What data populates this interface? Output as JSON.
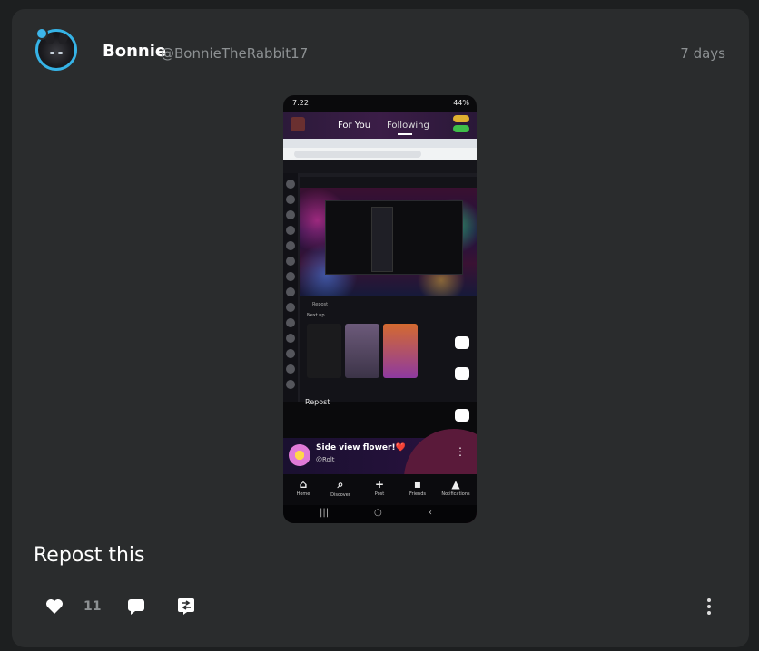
{
  "post": {
    "author_name": "Bonnie",
    "author_handle": "@BonnieTheRabbit17",
    "time": "7 days",
    "title": "Repost this",
    "like_count": "11"
  },
  "screenshot": {
    "status_time": "7:22",
    "status_right": "44%",
    "tab_for_you": "For You",
    "tab_following": "Following",
    "next_up": "Next up",
    "repost_label": "Repost",
    "repost_mini": "Repost",
    "caption_title": "Side view flower!❤️",
    "caption_user": "@Rolt",
    "nav": [
      "Home",
      "Discover",
      "Post",
      "Friends",
      "Notifications"
    ]
  },
  "icons": {
    "like": "heart-icon",
    "comment": "comment-icon",
    "repost": "repost-icon",
    "more": "more-vertical-icon"
  },
  "colors": {
    "background": "#1d1f20",
    "card": "#2a2c2d",
    "accent": "#36b3e6",
    "muted": "#8d9193"
  }
}
